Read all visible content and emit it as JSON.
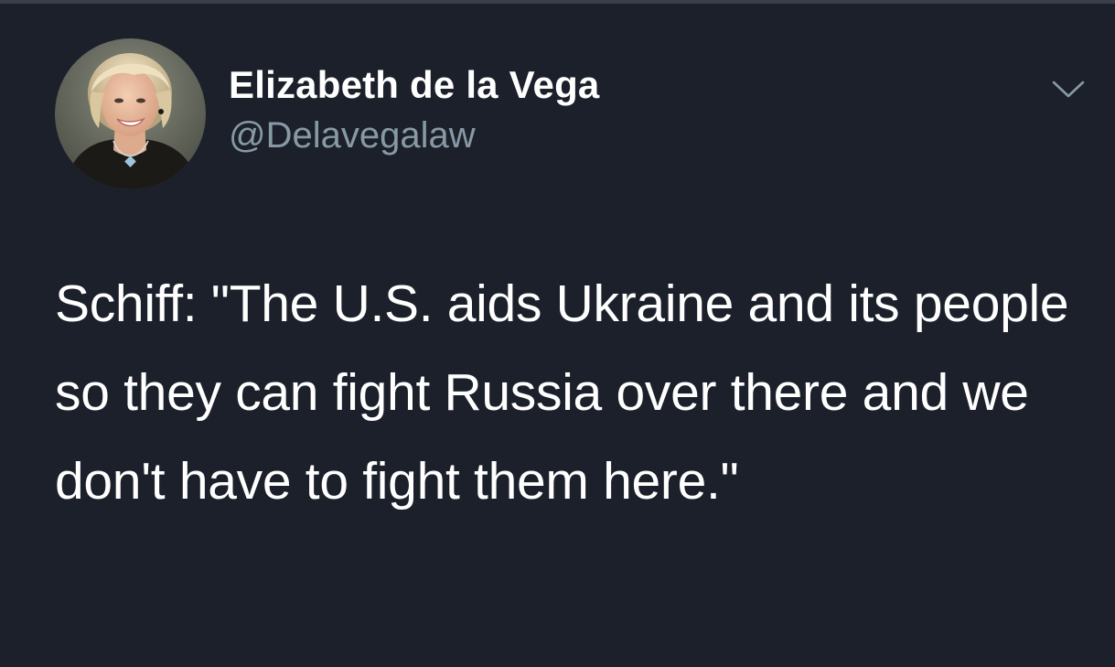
{
  "author": {
    "display_name": "Elizabeth de la Vega",
    "handle": "@Delavegalaw"
  },
  "tweet": {
    "text": "Schiff: \"The U.S. aids Ukraine and its people so they can fight Russia over there and we don't have to fight them here.\""
  },
  "icons": {
    "menu": "chevron-down-icon"
  },
  "colors": {
    "background": "#1b202a",
    "primary_text": "#ffffff",
    "secondary_text": "#8899a6"
  }
}
